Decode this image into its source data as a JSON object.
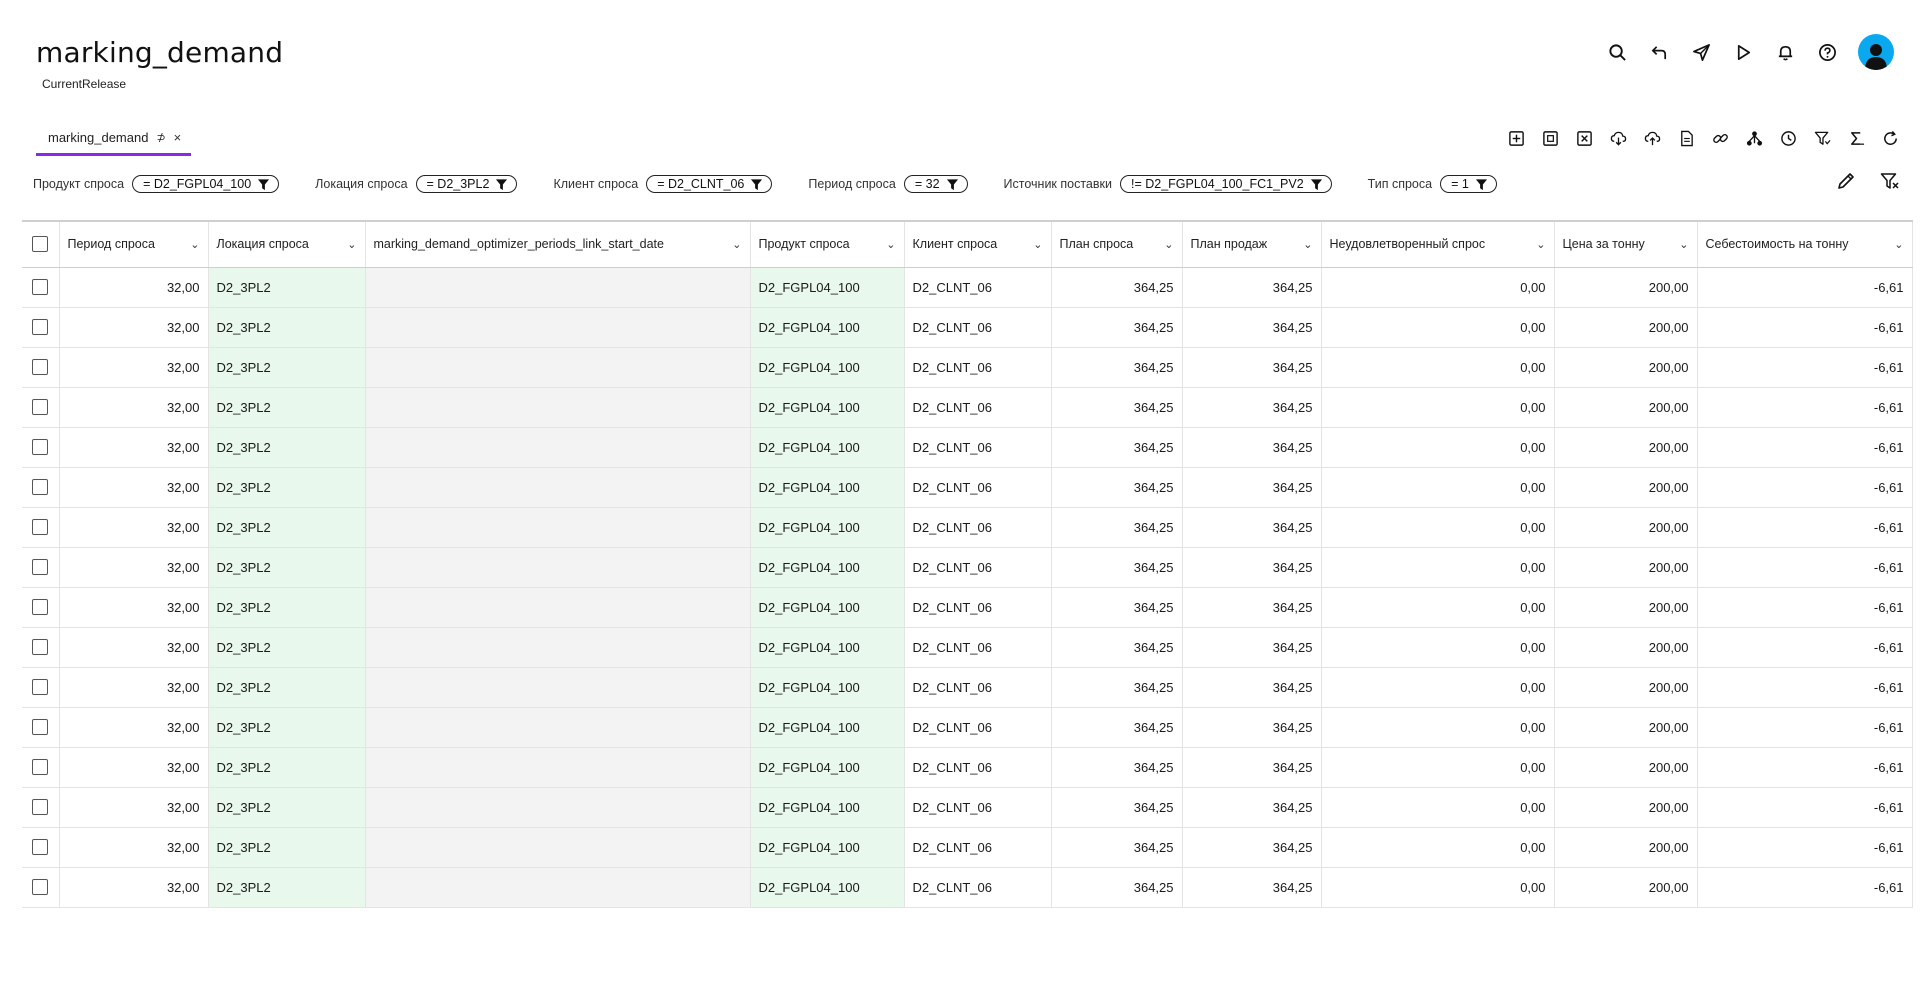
{
  "header": {
    "title": "marking_demand",
    "subtitle": "CurrentRelease"
  },
  "top_icons": [
    "search-icon",
    "undo-icon",
    "send-icon",
    "play-icon",
    "bell-icon",
    "help-icon",
    "avatar"
  ],
  "tabs": [
    {
      "label": "marking_demand",
      "pin": "⊅",
      "close": "×"
    }
  ],
  "toolbar_icons": [
    "add-row-icon",
    "copy-row-icon",
    "delete-row-icon",
    "cloud-download-icon",
    "cloud-upload-icon",
    "file-icon",
    "link-icon",
    "hierarchy-icon",
    "history-icon",
    "filter-sort-icon",
    "sum-icon",
    "refresh-icon"
  ],
  "filters": [
    {
      "label": "Продукт спроса",
      "value": "= D2_FGPL04_100"
    },
    {
      "label": "Локация спроса",
      "value": "= D2_3PL2"
    },
    {
      "label": "Клиент спроса",
      "value": "= D2_CLNT_06"
    },
    {
      "label": "Период спроса",
      "value": "= 32"
    },
    {
      "label": "Источник поставки",
      "value": "!= D2_FGPL04_100_FC1_PV2"
    },
    {
      "label": "Тип спроса",
      "value": "= 1"
    }
  ],
  "table": {
    "columns": [
      "Период спроса",
      "Локация спроса",
      "marking_demand_optimizer_periods_link_start_date",
      "Продукт спроса",
      "Клиент спроса",
      "План спроса",
      "План продаж",
      "Неудовлетворенный спрос",
      "Цена за тонну",
      "Себестоимость на тонну"
    ],
    "rows": [
      [
        "32,00",
        "D2_3PL2",
        "",
        "D2_FGPL04_100",
        "D2_CLNT_06",
        "364,25",
        "364,25",
        "0,00",
        "200,00",
        "-6,61"
      ],
      [
        "32,00",
        "D2_3PL2",
        "",
        "D2_FGPL04_100",
        "D2_CLNT_06",
        "364,25",
        "364,25",
        "0,00",
        "200,00",
        "-6,61"
      ],
      [
        "32,00",
        "D2_3PL2",
        "",
        "D2_FGPL04_100",
        "D2_CLNT_06",
        "364,25",
        "364,25",
        "0,00",
        "200,00",
        "-6,61"
      ],
      [
        "32,00",
        "D2_3PL2",
        "",
        "D2_FGPL04_100",
        "D2_CLNT_06",
        "364,25",
        "364,25",
        "0,00",
        "200,00",
        "-6,61"
      ],
      [
        "32,00",
        "D2_3PL2",
        "",
        "D2_FGPL04_100",
        "D2_CLNT_06",
        "364,25",
        "364,25",
        "0,00",
        "200,00",
        "-6,61"
      ],
      [
        "32,00",
        "D2_3PL2",
        "",
        "D2_FGPL04_100",
        "D2_CLNT_06",
        "364,25",
        "364,25",
        "0,00",
        "200,00",
        "-6,61"
      ],
      [
        "32,00",
        "D2_3PL2",
        "",
        "D2_FGPL04_100",
        "D2_CLNT_06",
        "364,25",
        "364,25",
        "0,00",
        "200,00",
        "-6,61"
      ],
      [
        "32,00",
        "D2_3PL2",
        "",
        "D2_FGPL04_100",
        "D2_CLNT_06",
        "364,25",
        "364,25",
        "0,00",
        "200,00",
        "-6,61"
      ],
      [
        "32,00",
        "D2_3PL2",
        "",
        "D2_FGPL04_100",
        "D2_CLNT_06",
        "364,25",
        "364,25",
        "0,00",
        "200,00",
        "-6,61"
      ],
      [
        "32,00",
        "D2_3PL2",
        "",
        "D2_FGPL04_100",
        "D2_CLNT_06",
        "364,25",
        "364,25",
        "0,00",
        "200,00",
        "-6,61"
      ],
      [
        "32,00",
        "D2_3PL2",
        "",
        "D2_FGPL04_100",
        "D2_CLNT_06",
        "364,25",
        "364,25",
        "0,00",
        "200,00",
        "-6,61"
      ],
      [
        "32,00",
        "D2_3PL2",
        "",
        "D2_FGPL04_100",
        "D2_CLNT_06",
        "364,25",
        "364,25",
        "0,00",
        "200,00",
        "-6,61"
      ],
      [
        "32,00",
        "D2_3PL2",
        "",
        "D2_FGPL04_100",
        "D2_CLNT_06",
        "364,25",
        "364,25",
        "0,00",
        "200,00",
        "-6,61"
      ],
      [
        "32,00",
        "D2_3PL2",
        "",
        "D2_FGPL04_100",
        "D2_CLNT_06",
        "364,25",
        "364,25",
        "0,00",
        "200,00",
        "-6,61"
      ],
      [
        "32,00",
        "D2_3PL2",
        "",
        "D2_FGPL04_100",
        "D2_CLNT_06",
        "364,25",
        "364,25",
        "0,00",
        "200,00",
        "-6,61"
      ],
      [
        "32,00",
        "D2_3PL2",
        "",
        "D2_FGPL04_100",
        "D2_CLNT_06",
        "364,25",
        "364,25",
        "0,00",
        "200,00",
        "-6,61"
      ]
    ]
  },
  "colors": {
    "accent": "#8a2be2",
    "avatar": "#0aa8ee",
    "dim_cell": "#e9f8ec",
    "empty_cell": "#f3f3f4"
  }
}
